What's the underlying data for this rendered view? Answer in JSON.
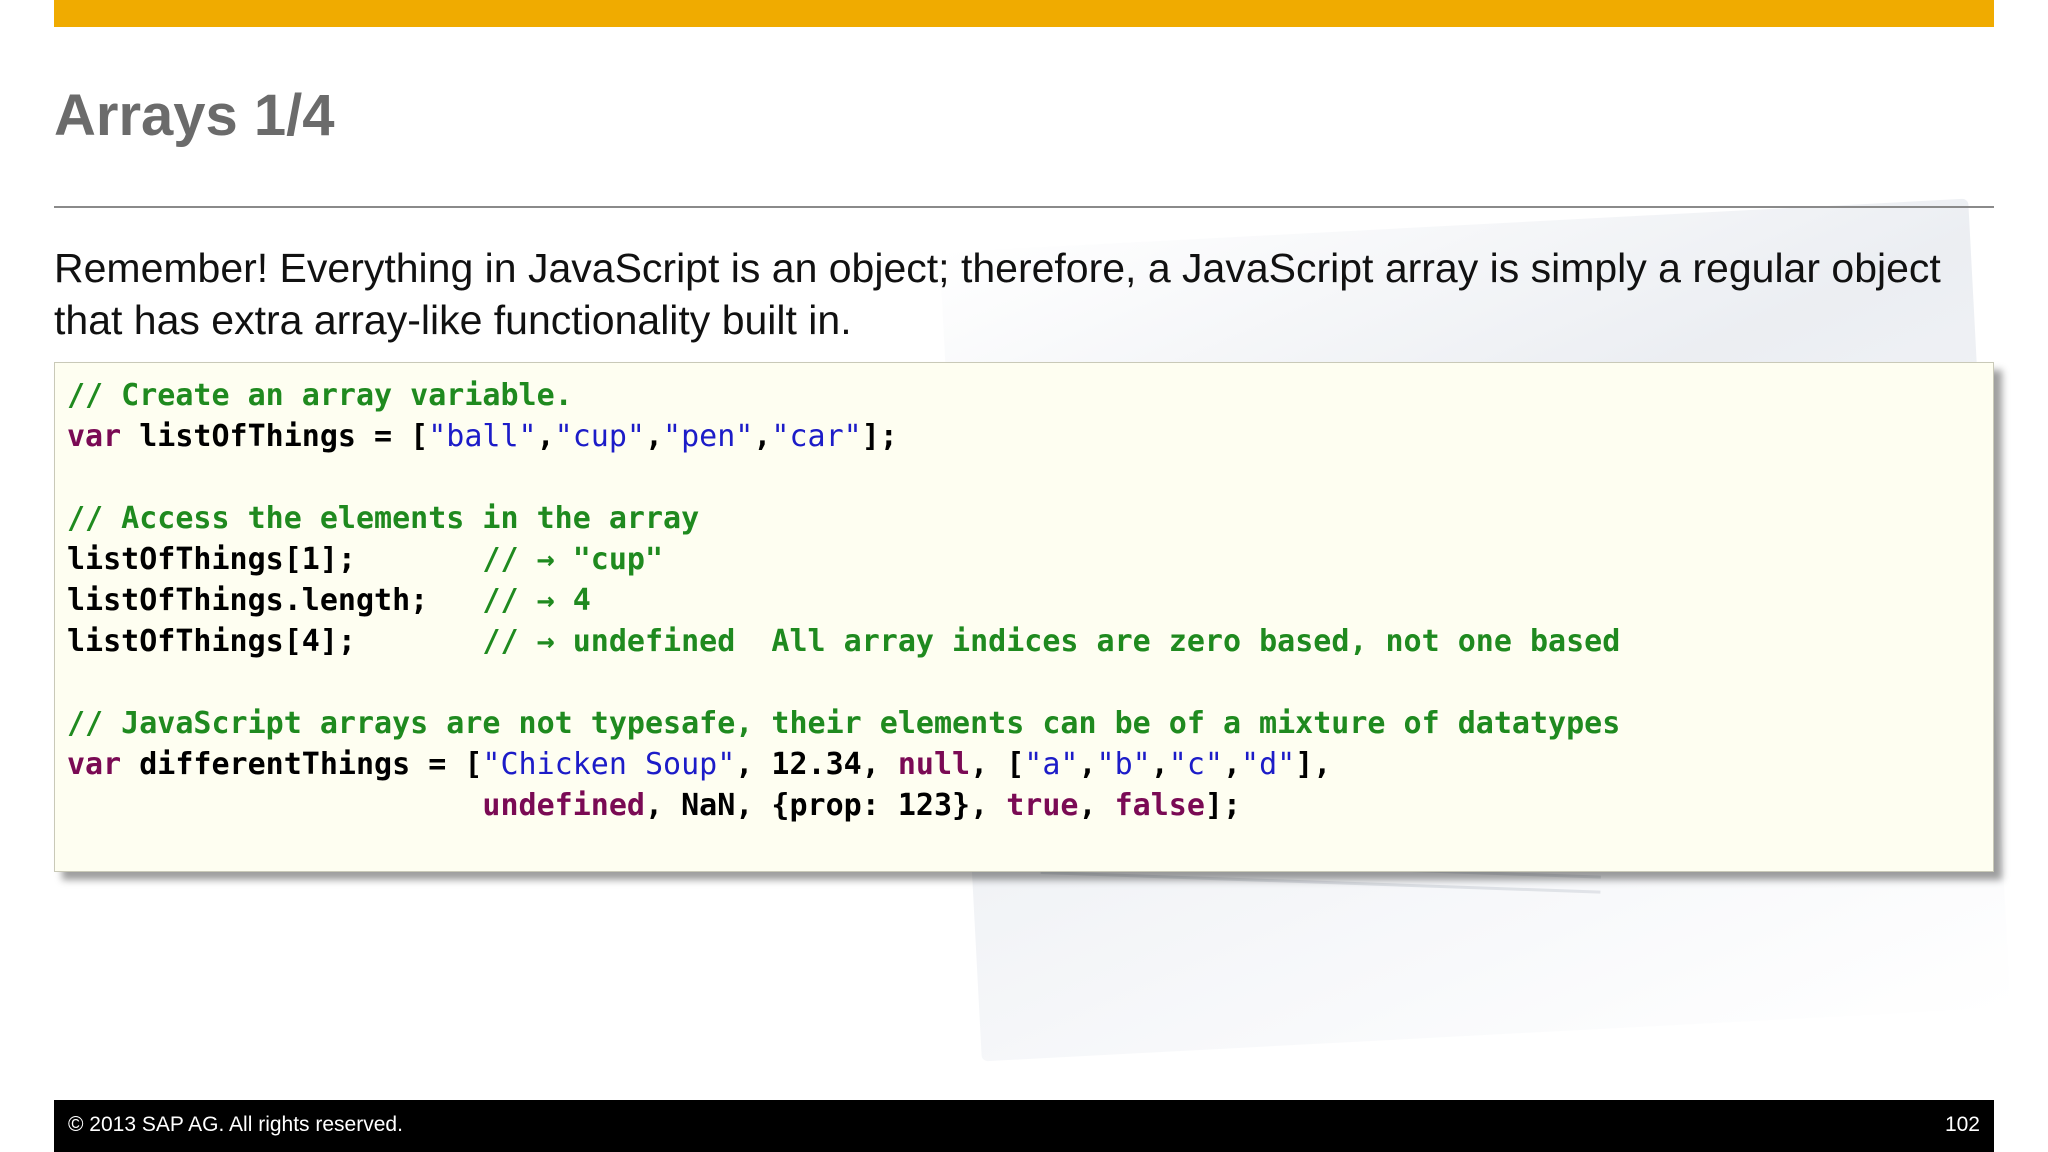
{
  "slide": {
    "title": "Arrays 1/4",
    "intro": "Remember!  Everything in JavaScript is an object; therefore, a JavaScript array is simply a regular object that has extra array-like functionality built in.",
    "code": {
      "comment_create": "// Create an array variable.",
      "kw_var": "var",
      "var1_decl": " listOfThings = [",
      "str_ball": "\"ball\"",
      "str_cup": "\"cup\"",
      "str_pen": "\"pen\"",
      "str_car": "\"car\"",
      "comma": ",",
      "close_semi": "];",
      "comment_access": "// Access the elements in the array",
      "access1": "listOfThings[1];       ",
      "comment_cup": "// → \"cup\"",
      "access2": "listOfThings.length;   ",
      "comment_len": "// → 4",
      "access3": "listOfThings[4];       ",
      "comment_undef": "// → undefined  All array indices are zero based, not one based",
      "comment_mixed": "// JavaScript arrays are not typesafe, their elements can be of a mixture of datatypes",
      "var2_decl": " differentThings = [",
      "str_chicken": "\"Chicken Soup\"",
      "num_part": ", 12.34, ",
      "kw_null": "null",
      "open_inner": ", [",
      "str_a": "\"a\"",
      "str_b": "\"b\"",
      "str_c": "\"c\"",
      "str_d": "\"d\"",
      "close_inner": "],",
      "indent": "                       ",
      "kw_undefined": "undefined",
      "nan_part": ", NaN, {prop: 123}, ",
      "kw_true": "true",
      "sep": ", ",
      "kw_false": "false"
    }
  },
  "footer": {
    "copyright": "©  2013 SAP AG. All rights reserved.",
    "page_number": "102"
  },
  "colors": {
    "accent": "#f0ab00",
    "comment": "#1f8a1f",
    "keyword": "#7a0a54",
    "string": "#1c1cc8",
    "code_bg": "#fefef1"
  }
}
